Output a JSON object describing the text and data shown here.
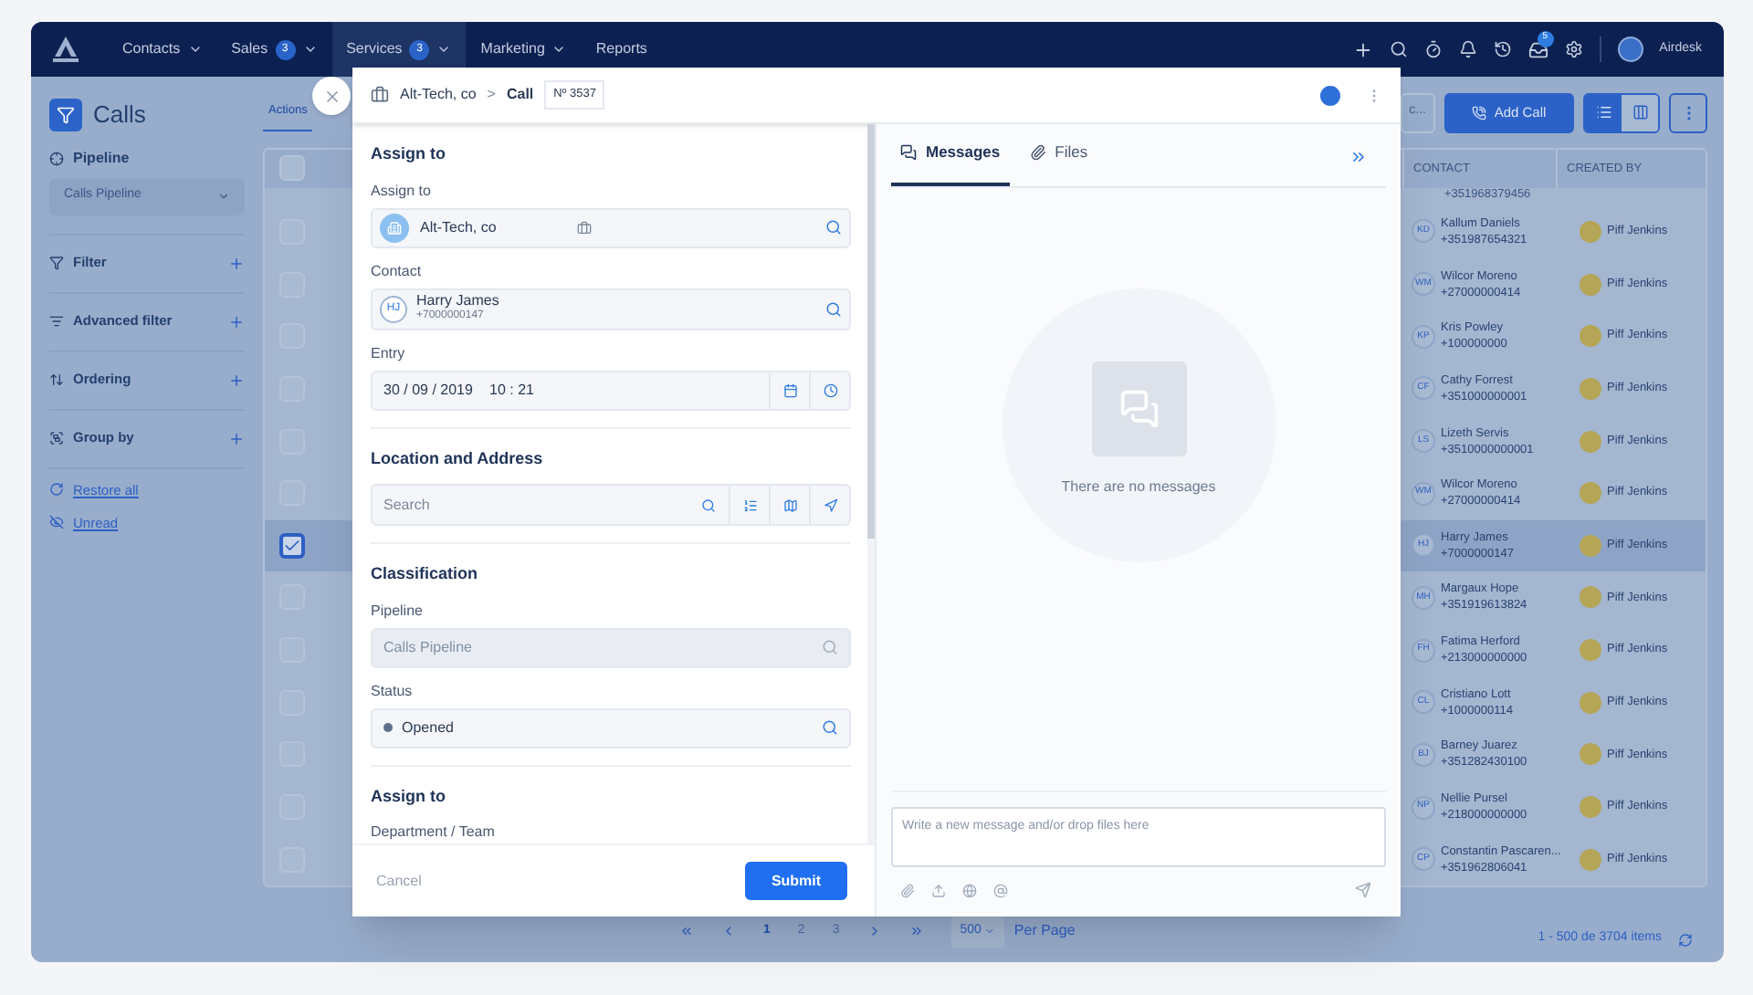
{
  "top_nav": {
    "items": [
      {
        "label": "Contacts",
        "selected": false
      },
      {
        "label": "Sales",
        "badge": "3",
        "selected": false
      },
      {
        "label": "Services",
        "badge": "3",
        "selected": true
      },
      {
        "label": "Marketing",
        "selected": false
      },
      {
        "label": "Reports",
        "selected": false
      }
    ],
    "inbox_badge": "5",
    "user": "Airdesk"
  },
  "sidebar": {
    "title": "Calls",
    "pipeline_label": "Pipeline",
    "pipeline_value": "Calls Pipeline",
    "sections": [
      {
        "label": "Filter",
        "kind": "filter"
      },
      {
        "label": "Advanced filter",
        "kind": "advanced"
      },
      {
        "label": "Ordering",
        "kind": "ordering"
      },
      {
        "label": "Group by",
        "kind": "group"
      }
    ],
    "links": [
      {
        "label": "Restore all",
        "kind": "restore"
      },
      {
        "label": "Unread",
        "kind": "unread"
      }
    ]
  },
  "toolbar": {
    "actions": "Actions",
    "truncated_button": "c...",
    "add_call": "Add Call",
    "views": [
      {
        "kind": "list",
        "selected": true
      },
      {
        "kind": "board",
        "selected": false
      }
    ]
  },
  "table": {
    "header_checked": false,
    "columns": [
      "CONTACT",
      "CREATED BY"
    ],
    "rows": [
      {
        "kind": "partial",
        "phone": "+351968379456",
        "selected": false
      },
      {
        "kind": "row",
        "initials": "KD",
        "name": "Kallum Daniels",
        "phone": "+351987654321",
        "creator": "Piff Jenkins",
        "checked": false,
        "selected": false
      },
      {
        "kind": "row",
        "initials": "WM",
        "name": "Wilcor Moreno",
        "phone": "+27000000414",
        "creator": "Piff Jenkins",
        "checked": false,
        "selected": false
      },
      {
        "kind": "row",
        "initials": "KP",
        "name": "Kris Powley",
        "phone": "+100000000",
        "creator": "Piff Jenkins",
        "checked": false,
        "selected": false
      },
      {
        "kind": "row",
        "initials": "CF",
        "name": "Cathy Forrest",
        "phone": "+351000000001",
        "creator": "Piff Jenkins",
        "checked": false,
        "selected": false
      },
      {
        "kind": "row",
        "initials": "LS",
        "name": "Lizeth Servis",
        "phone": "+3510000000001",
        "creator": "Piff Jenkins",
        "checked": false,
        "selected": false
      },
      {
        "kind": "row",
        "initials": "WM",
        "name": "Wilcor Moreno",
        "phone": "+27000000414",
        "creator": "Piff Jenkins",
        "checked": false,
        "selected": false
      },
      {
        "kind": "row",
        "initials": "HJ",
        "name": "Harry James",
        "phone": "+7000000147",
        "creator": "Piff Jenkins",
        "checked": true,
        "selected": true
      },
      {
        "kind": "row",
        "initials": "MH",
        "name": "Margaux Hope",
        "phone": "+351919613824",
        "creator": "Piff Jenkins",
        "checked": false,
        "selected": false
      },
      {
        "kind": "row",
        "initials": "FH",
        "name": "Fatima Herford",
        "phone": "+213000000000",
        "creator": "Piff Jenkins",
        "checked": false,
        "selected": false
      },
      {
        "kind": "row",
        "initials": "CL",
        "name": "Cristiano Lott",
        "phone": "+1000000114",
        "creator": "Piff Jenkins",
        "checked": false,
        "selected": false
      },
      {
        "kind": "row",
        "initials": "BJ",
        "name": "Barney Juarez",
        "phone": "+351282430100",
        "creator": "Piff Jenkins",
        "checked": false,
        "selected": false
      },
      {
        "kind": "row",
        "initials": "NP",
        "name": "Nellie Pursel",
        "phone": "+218000000000",
        "creator": "Piff Jenkins",
        "checked": false,
        "selected": false
      },
      {
        "kind": "row",
        "initials": "CP",
        "name": "Constantin Pascaren...",
        "phone": "+351962806041",
        "creator": "Piff Jenkins",
        "checked": false,
        "selected": false
      }
    ]
  },
  "pagination": {
    "pages": [
      {
        "label": "1",
        "selected": true
      },
      {
        "label": "2",
        "selected": false
      },
      {
        "label": "3",
        "selected": false
      }
    ],
    "per_page": "500",
    "per_page_label": "Per Page",
    "summary": "1 - 500 de 3704 items"
  },
  "modal": {
    "company": "Alt-Tech, co",
    "separator": ">",
    "entity": "Call",
    "number": "Nº 3537",
    "sections": [
      {
        "title": "Assign to",
        "fields": [
          {
            "kind": "entity",
            "label": "Assign to",
            "value": "Alt-Tech, co"
          },
          {
            "kind": "contact",
            "label": "Contact",
            "initials": "HJ",
            "value": "Harry James",
            "sub": "+7000000147"
          },
          {
            "kind": "datetime",
            "label": "Entry",
            "date": "30 / 09 / 2019",
            "time": "10 : 21"
          }
        ]
      },
      {
        "title": "Location and Address",
        "fields": [
          {
            "kind": "address",
            "placeholder": "Search"
          }
        ]
      },
      {
        "title": "Classification",
        "fields": [
          {
            "kind": "lookup",
            "label": "Pipeline",
            "value": "Calls Pipeline",
            "disabled": true
          },
          {
            "kind": "status",
            "label": "Status",
            "value": "Opened"
          }
        ]
      },
      {
        "title": "Assign to",
        "fields": [
          {
            "kind": "label_only",
            "label": "Department / Team"
          }
        ]
      }
    ],
    "cancel": "Cancel",
    "submit": "Submit",
    "tabs": [
      {
        "kind": "messages",
        "label": "Messages",
        "selected": true
      },
      {
        "kind": "files",
        "label": "Files",
        "selected": false
      }
    ],
    "empty_text": "There are no messages",
    "composer_placeholder": "Write a new message and/or drop files here"
  }
}
